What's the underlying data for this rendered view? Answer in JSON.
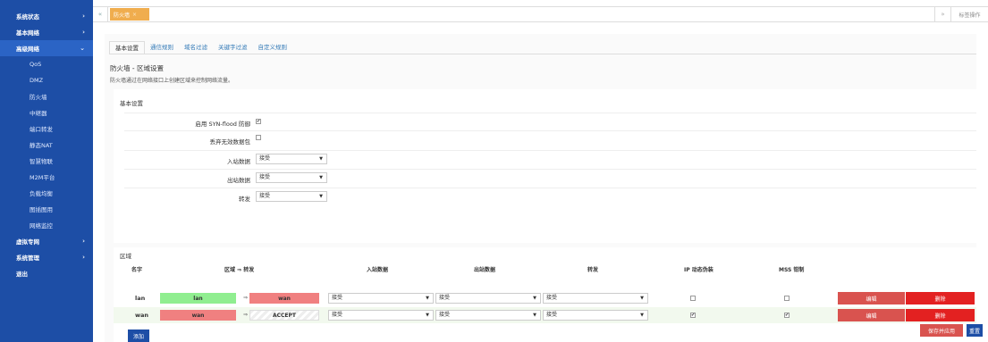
{
  "sidebar": {
    "items": [
      {
        "label": "系统状态",
        "arrow": "›"
      },
      {
        "label": "基本网络",
        "arrow": "›"
      },
      {
        "label": "高级网络",
        "arrow": "⌄"
      },
      {
        "label": "虚拟专网",
        "arrow": "›"
      },
      {
        "label": "系统管理",
        "arrow": "›"
      },
      {
        "label": "退出",
        "arrow": ""
      }
    ],
    "subitems": [
      "QoS",
      "DMZ",
      "防火墙",
      "中继器",
      "端口转发",
      "静态NAT",
      "智慧物联",
      "M2M平台",
      "负载均衡",
      "图插图用",
      "网络监控"
    ]
  },
  "topbar": {
    "left_arrow": "«",
    "tab_label": "防火墙",
    "tab_close": "×",
    "right_arrow": "»",
    "ops_label": "标签操作"
  },
  "tabs": [
    "基本设置",
    "通信规则",
    "域名过滤",
    "关键字过滤",
    "自定义规则"
  ],
  "section": {
    "title": "防火墙 - 区域设置",
    "desc": "防火墙通过在网络接口上创建区域来控制网络流量。"
  },
  "basic": {
    "legend": "基本设置",
    "syn_label": "启用 SYN-flood 防御",
    "syn_checked": "✔",
    "drop_label": "丢弃无效数据包",
    "drop_checked": "",
    "in_label": "入站数据",
    "in_value": "接受",
    "out_label": "出站数据",
    "out_value": "接受",
    "fwd_label": "转发",
    "fwd_value": "接受",
    "caret": "▼"
  },
  "zone": {
    "legend": "区域",
    "headers": {
      "name": "名字",
      "zone_fwd": "区域 ⇒ 转发",
      "input": "入站数据",
      "output": "出站数据",
      "forward": "转发",
      "masq": "IP 动态伪装",
      "mss": "MSS 钳制"
    },
    "rows": [
      {
        "name": "lan",
        "zone": "lan",
        "arrow": "⇒",
        "target": "wan",
        "input": "接受",
        "output": "接受",
        "forward": "接受",
        "masq": "",
        "mss": "",
        "edit": "编辑",
        "delete": "删除"
      },
      {
        "name": "wan",
        "zone": "wan",
        "arrow": "⇒",
        "target": "ACCEPT",
        "input": "接受",
        "output": "接受",
        "forward": "接受",
        "masq": "✔",
        "mss": "✔",
        "edit": "编辑",
        "delete": "删除"
      }
    ],
    "add_label": "添加"
  },
  "footer": {
    "save_label": "保存并应用",
    "reset_label": "重置"
  }
}
